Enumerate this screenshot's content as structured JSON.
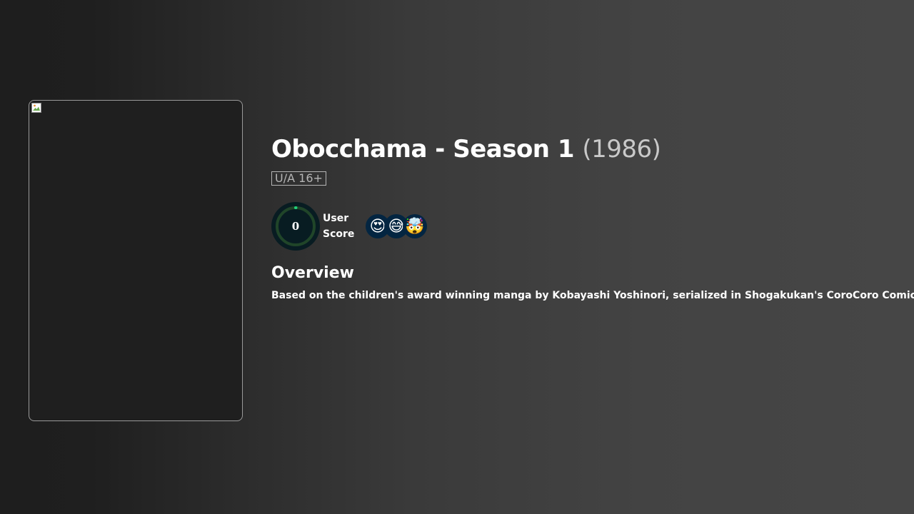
{
  "show": {
    "title": "Obocchama - Season 1",
    "year": "(1986)",
    "certification": "U/A 16+"
  },
  "score": {
    "value": "0",
    "label": "User Score",
    "percent": 0
  },
  "reactions": [
    {
      "emoji": "😍",
      "icon": "heart-eyes-emoji-icon"
    },
    {
      "emoji": "😅",
      "icon": "sweat-smile-emoji-icon"
    },
    {
      "emoji": "🤯",
      "icon": "exploding-head-emoji-icon"
    }
  ],
  "overview": {
    "heading": "Overview",
    "text": "Based on the children's award winning manga by Kobayashi Yoshinori, serialized in Shogakukan's CoroCoro Comic."
  },
  "colors": {
    "score_ring_track": "#204529",
    "score_ring_fill": "#21d07a",
    "score_background": "#081c22"
  }
}
